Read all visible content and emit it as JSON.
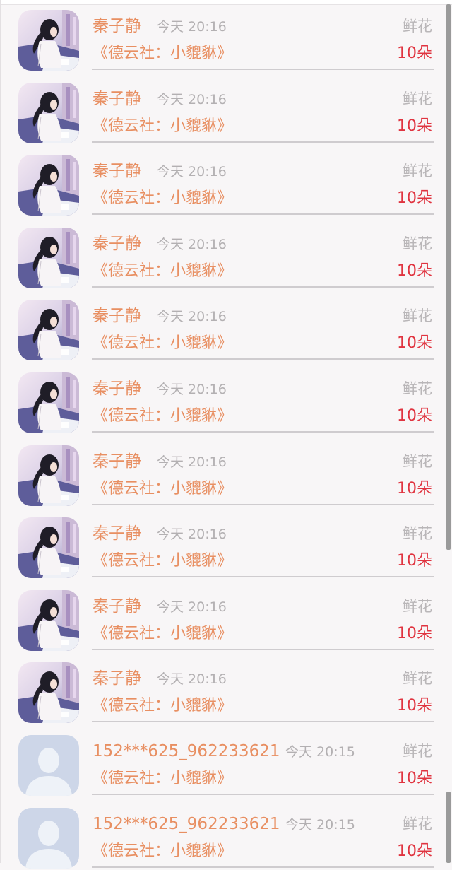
{
  "gifts": [
    {
      "avatar": "girl-illustration-avatar",
      "name": "秦子静",
      "time": "今天 20:16",
      "gift_label": "鲜花",
      "work": "《德云社：小貔貅》",
      "count": "10朵"
    },
    {
      "avatar": "girl-illustration-avatar",
      "name": "秦子静",
      "time": "今天 20:16",
      "gift_label": "鲜花",
      "work": "《德云社：小貔貅》",
      "count": "10朵"
    },
    {
      "avatar": "girl-illustration-avatar",
      "name": "秦子静",
      "time": "今天 20:16",
      "gift_label": "鲜花",
      "work": "《德云社：小貔貅》",
      "count": "10朵"
    },
    {
      "avatar": "girl-illustration-avatar",
      "name": "秦子静",
      "time": "今天 20:16",
      "gift_label": "鲜花",
      "work": "《德云社：小貔貅》",
      "count": "10朵"
    },
    {
      "avatar": "girl-illustration-avatar",
      "name": "秦子静",
      "time": "今天 20:16",
      "gift_label": "鲜花",
      "work": "《德云社：小貔貅》",
      "count": "10朵"
    },
    {
      "avatar": "girl-illustration-avatar",
      "name": "秦子静",
      "time": "今天 20:16",
      "gift_label": "鲜花",
      "work": "《德云社：小貔貅》",
      "count": "10朵"
    },
    {
      "avatar": "girl-illustration-avatar",
      "name": "秦子静",
      "time": "今天 20:16",
      "gift_label": "鲜花",
      "work": "《德云社：小貔貅》",
      "count": "10朵"
    },
    {
      "avatar": "girl-illustration-avatar",
      "name": "秦子静",
      "time": "今天 20:16",
      "gift_label": "鲜花",
      "work": "《德云社：小貔貅》",
      "count": "10朵"
    },
    {
      "avatar": "girl-illustration-avatar",
      "name": "秦子静",
      "time": "今天 20:16",
      "gift_label": "鲜花",
      "work": "《德云社：小貔貅》",
      "count": "10朵"
    },
    {
      "avatar": "girl-illustration-avatar",
      "name": "秦子静",
      "time": "今天 20:16",
      "gift_label": "鲜花",
      "work": "《德云社：小貔貅》",
      "count": "10朵"
    },
    {
      "avatar": "default-person-avatar",
      "name": "152***625_962233621",
      "time": "今天 20:15",
      "gift_label": "鲜花",
      "work": "《德云社：小貔貅》",
      "count": "10朵"
    },
    {
      "avatar": "default-person-avatar",
      "name": "152***625_962233621",
      "time": "今天 20:15",
      "gift_label": "鲜花",
      "work": "《德云社：小貔貅》",
      "count": "10朵"
    }
  ],
  "colors": {
    "name": "#e88f62",
    "count": "#e03440",
    "muted": "#b3b0b2",
    "divider": "#cfcccf",
    "background": "#f8f6f7"
  }
}
